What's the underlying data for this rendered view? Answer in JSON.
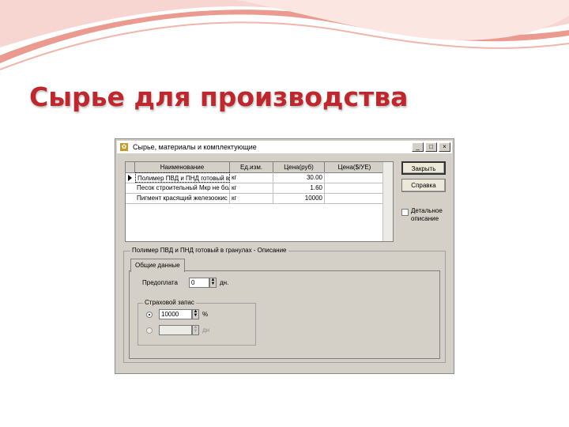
{
  "slide": {
    "title": "Сырье для производства"
  },
  "window": {
    "title": "Сырье, материалы и комплектующие",
    "controls": {
      "minimize": "_",
      "maximize": "□",
      "close": "×"
    }
  },
  "table": {
    "columns": [
      "Наименование",
      "Ед.изм.",
      "Цена(руб)",
      "Цена($/УЕ)"
    ],
    "rows": [
      {
        "name": "Полимер ПВД и ПНД готовый в",
        "unit": "кг",
        "price_rub": "30.00",
        "price_usd": ""
      },
      {
        "name": "Песок строительный Мкр не бол",
        "unit": "кг",
        "price_rub": "1.60",
        "price_usd": ""
      },
      {
        "name": "Пигмент красящий железоокис",
        "unit": "кг",
        "price_rub": "10000",
        "price_usd": ""
      }
    ]
  },
  "buttons": {
    "close": "Закрыть",
    "help": "Справка"
  },
  "checkbox": {
    "label": "Детальное описание",
    "checked": false
  },
  "details": {
    "legend": "Полимер ПВД и ПНД готовый в гранулах - Описание",
    "tab": "Общие данные",
    "prepay": {
      "label": "Предоплата",
      "value": "0",
      "unit": "дн."
    },
    "stock": {
      "legend": "Страховой запас",
      "percent_value": "10000",
      "percent_unit": "%",
      "days_value": "",
      "days_unit": "дн",
      "selected": "percent"
    }
  },
  "colors": {
    "title_red": "#c0272d",
    "window_bg": "#d4d0c8"
  }
}
